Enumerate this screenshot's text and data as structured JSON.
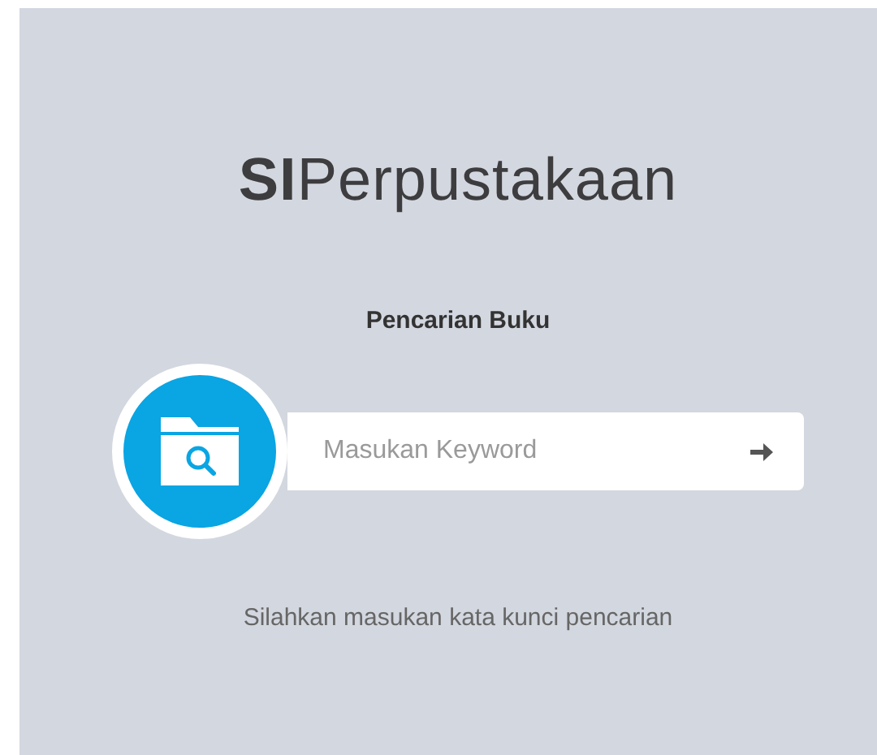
{
  "brand": "**SI**Perpustakaan",
  "heading": "Pencarian Buku",
  "search": {
    "placeholder": "Masukan Keyword"
  },
  "hint": "Silahkan masukan kata kunci pencarian"
}
